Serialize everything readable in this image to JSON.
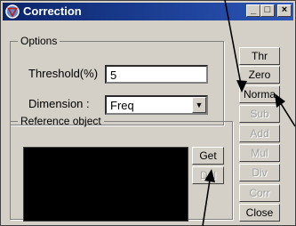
{
  "window": {
    "title": "Correction",
    "min_glyph": "_",
    "max_glyph": "□",
    "close_glyph": "×"
  },
  "options": {
    "legend": "Options",
    "threshold_label": "Threshold(%)",
    "threshold_value": "5",
    "dimension_label": "Dimension :",
    "dimension_value": "Freq",
    "dropdown_arrow_glyph": "▼"
  },
  "reference": {
    "legend": "Reference object",
    "get_label": "Get",
    "del_label": "Del"
  },
  "side_buttons": {
    "thr": "Thr",
    "zero": "Zero",
    "norma": "Norma",
    "sub": "Sub",
    "add": "Add",
    "mul": "Mul",
    "div": "Div",
    "corr": "Corr",
    "close": "Close"
  }
}
